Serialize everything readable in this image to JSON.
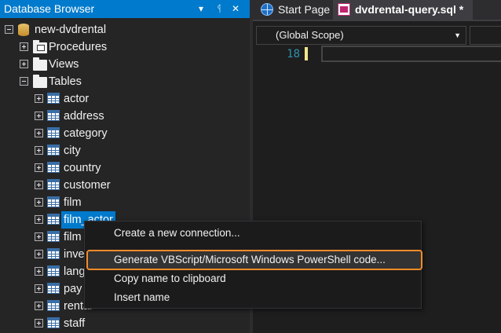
{
  "panel": {
    "title": "Database Browser",
    "menu_glyph": "▾",
    "pin_glyph": "ᛩ",
    "close_glyph": "✕"
  },
  "tree": {
    "connection": "new-dvdrental",
    "folders": {
      "procedures": "Procedures",
      "views": "Views",
      "tables": "Tables"
    },
    "tables": [
      "actor",
      "address",
      "category",
      "city",
      "country",
      "customer",
      "film",
      "film_actor",
      "film",
      "inve",
      "lang",
      "pay",
      "rental",
      "staff"
    ],
    "selected_table_index": 7
  },
  "tabs": [
    {
      "label": "Start Page",
      "icon": "globe-icon"
    },
    {
      "label": "dvdrental-query.sql *",
      "icon": "sql-file-icon"
    }
  ],
  "editor": {
    "scope": "(Global Scope)",
    "line_number": "18"
  },
  "context_menu": {
    "items": [
      "Create a new connection...",
      "Generate VBScript/Microsoft Windows PowerShell code...",
      "Copy name to clipboard",
      "Insert name"
    ],
    "highlighted_index": 1
  },
  "colors": {
    "accent": "#007acc",
    "highlight_outline": "#f28c28"
  }
}
